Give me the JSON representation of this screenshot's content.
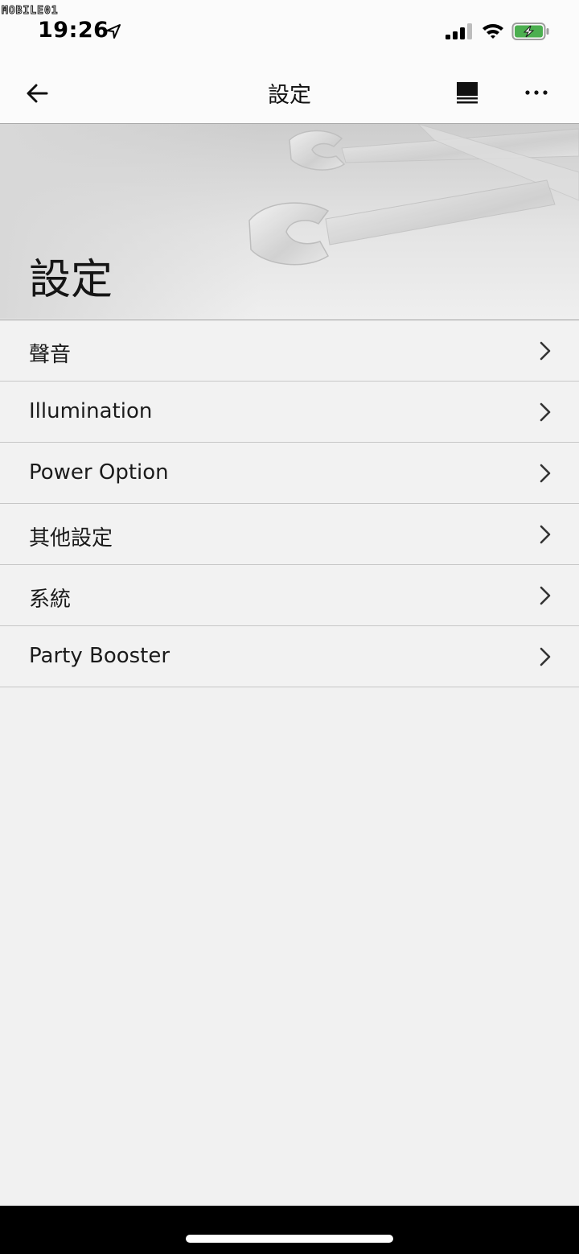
{
  "watermark": {
    "text": "MOBILE01"
  },
  "status_bar": {
    "time": "19:26",
    "icons": [
      "location-arrow-icon",
      "cellular-signal-icon",
      "wifi-icon",
      "battery-charging-icon"
    ],
    "battery_color": "#4caf50"
  },
  "nav_bar": {
    "title": "設定",
    "back_icon": "arrow-left-icon",
    "queue_icon": "queue-list-icon",
    "more_icon": "more-horizontal-icon"
  },
  "hero": {
    "title": "設定",
    "image": "wrenches-icon"
  },
  "settings": {
    "items": [
      {
        "label": "聲音"
      },
      {
        "label": "Illumination"
      },
      {
        "label": "Power Option"
      },
      {
        "label": "其他設定"
      },
      {
        "label": "系統"
      },
      {
        "label": "Party Booster"
      }
    ],
    "chevron_icon": "chevron-right-icon"
  }
}
